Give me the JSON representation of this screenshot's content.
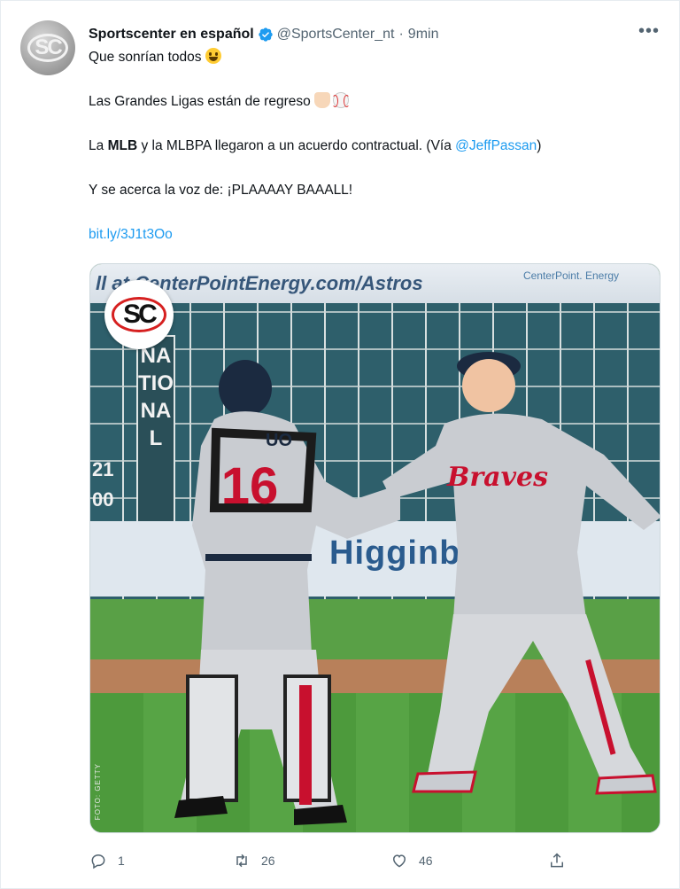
{
  "author": {
    "name": "Sportscenter en español",
    "handle": "@SportsCenter_nt",
    "separator": "·",
    "time": "9min",
    "avatar_text": "SC"
  },
  "more_label": "•••",
  "body": {
    "line1": "Que sonrían todos",
    "line2": "Las Grandes Ligas están de regreso",
    "line3_pre": "La ",
    "line3_bold": "MLB",
    "line3_mid": " y la MLBPA llegaron a un acuerdo contractual. (Vía ",
    "line3_link": "@JeffPassan",
    "line3_post": ")",
    "line4": "Y se acerca la voz de: ¡PLAAAAY BAAALL!",
    "url": "bit.ly/3J1t3Oo"
  },
  "photo": {
    "banner": "ll at CenterPointEnergy.com/Astros",
    "energy_logo": "CenterPoint. Energy",
    "national": "NATIONAL",
    "wall_sign": "Higginb    n",
    "badge": "SC",
    "catcher_name": "UO",
    "catcher_number": "16",
    "pitcher_script": "Braves",
    "credit": "FOTO: GETTY",
    "score_left": "21",
    "score_left2": "00"
  },
  "actions": {
    "reply_count": "1",
    "retweet_count": "26",
    "like_count": "46"
  },
  "colors": {
    "link": "#1d9bf0",
    "verified": "#1d9bf0",
    "secondary_text": "#536471"
  }
}
